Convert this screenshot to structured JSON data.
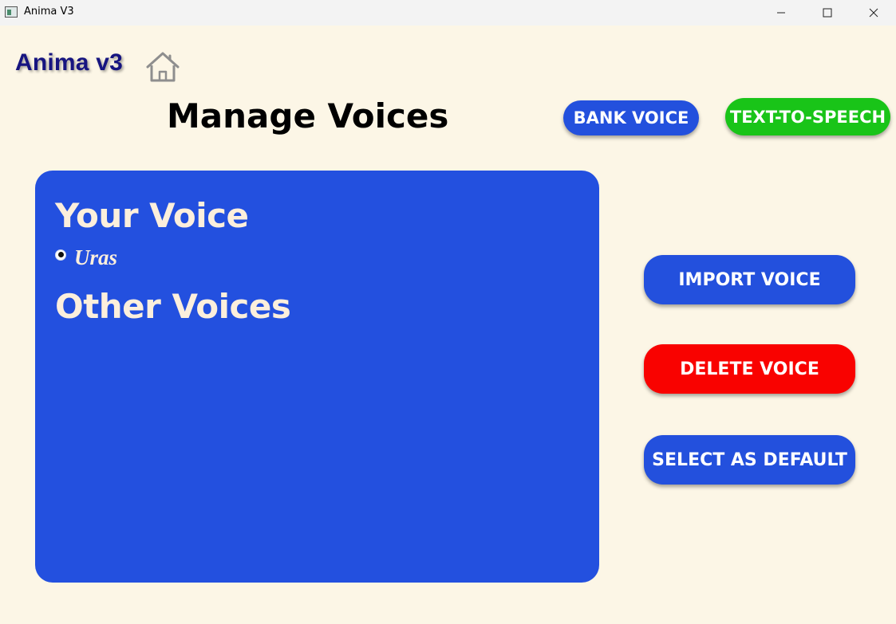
{
  "window": {
    "title": "Anima V3"
  },
  "header": {
    "brand": "Anima v3",
    "home_icon": "home-icon",
    "page_title": "Manage Voices",
    "bank_voice_label": "BANK VOICE",
    "tts_label": "TEXT-TO-SPEECH"
  },
  "voice_panel": {
    "your_voice_heading": "Your Voice",
    "voices": [
      {
        "name": "Uras",
        "selected": true
      }
    ],
    "other_voices_heading": "Other Voices",
    "other_voices": []
  },
  "actions": {
    "import_label": "IMPORT VOICE",
    "delete_label": "DELETE VOICE",
    "default_label": "SELECT AS DEFAULT"
  },
  "colors": {
    "background": "#fcf6e6",
    "panel_blue": "#2350df",
    "tts_green": "#19c418",
    "delete_red": "#f90200",
    "brand_navy": "#161480",
    "panel_text": "#fcefdc"
  }
}
